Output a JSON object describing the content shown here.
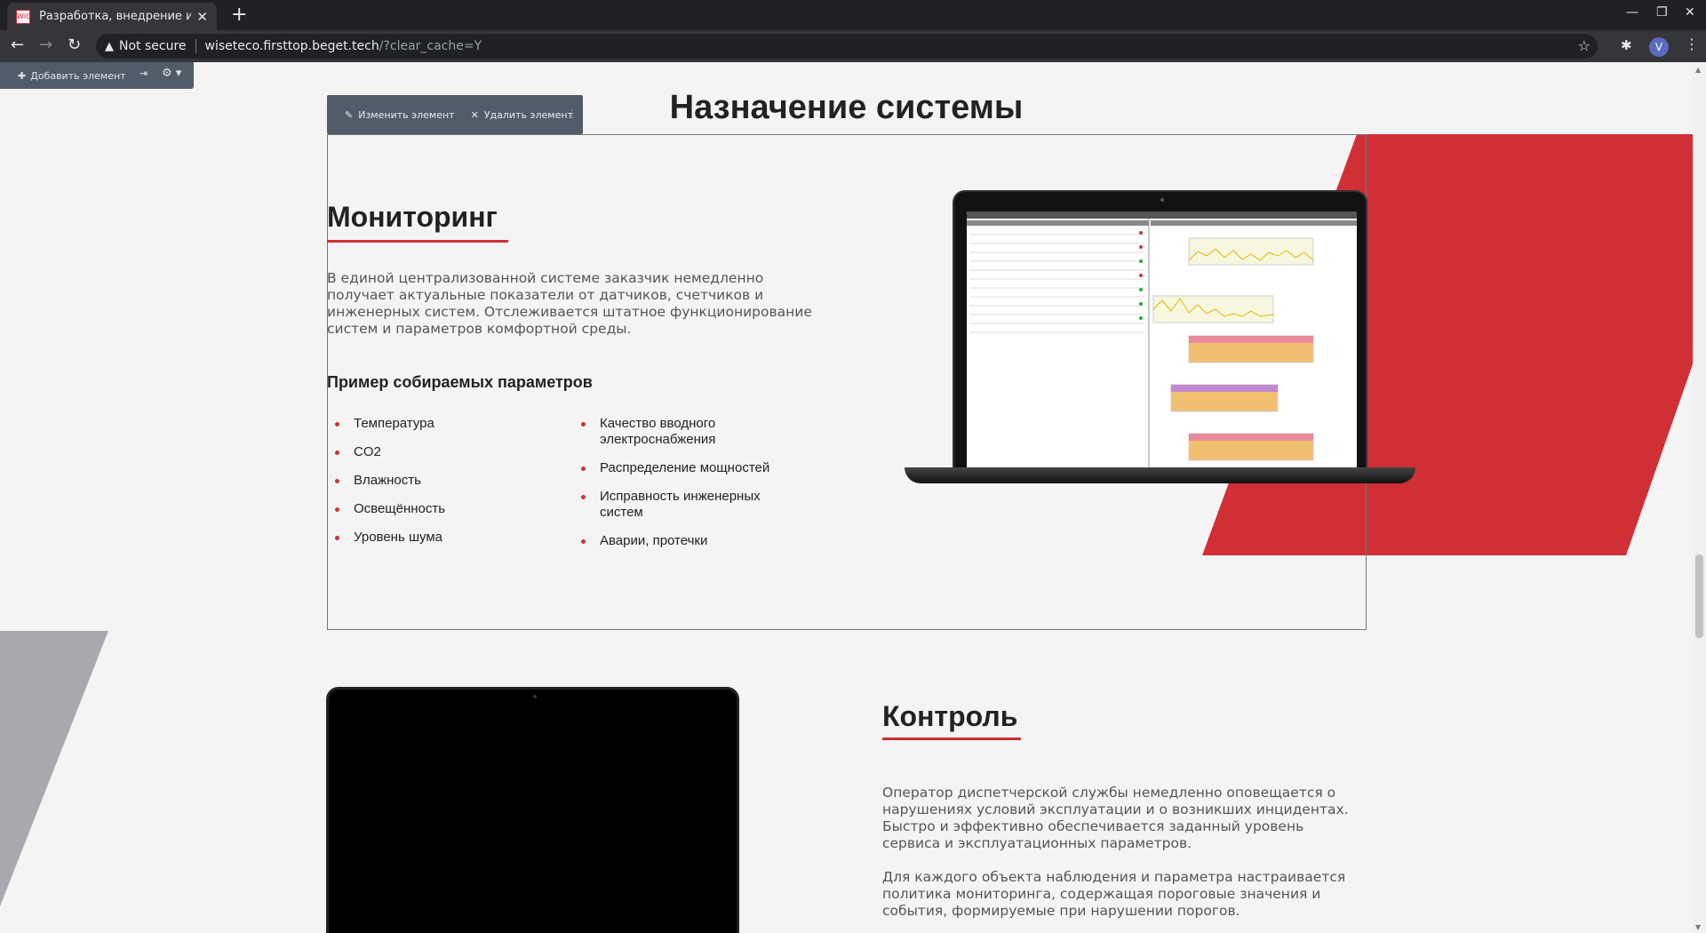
{
  "browser": {
    "tab_title": "Разработка, внедрение и пос",
    "tab_favicon_text": "WIC",
    "security_label": "Not secure",
    "url_host": "wiseteco.firsttop.beget.tech",
    "url_path": "/?clear_cache=Y",
    "profile_initial": "V"
  },
  "admin": {
    "add_element": "Добавить элемент",
    "edit_element": "Изменить элемент",
    "delete_element": "Удалить элемент"
  },
  "page": {
    "section_title": "Назначение системы",
    "monitoring": {
      "heading": "Мониторинг",
      "text": "В единой централизованной системе заказчик немедленно получает актуальные показатели от датчиков, счетчиков и инженерных систем. Отслеживается штатное функционирование систем и параметров комфортной среды.",
      "params_heading": "Пример собираемых параметров",
      "params_left": [
        "Температура",
        "CO2",
        "Влажность",
        "Освещённость",
        "Уровень шума"
      ],
      "params_right": [
        "Качество вводного электроснабжения",
        "Распределение мощностей",
        "Исправность инженерных систем",
        "Аварии, протечки"
      ]
    },
    "control": {
      "heading": "Контроль",
      "text1": "Оператор диспетчерской службы немедленно оповещается о нарушениях условий эксплуатации и о возникших инцидентах. Быстро и эффективно обеспечивается заданный уровень сервиса и эксплуатационных параметров.",
      "text2": "Для каждого объекта наблюдения и параметра настраивается политика мониторинга, содержащая пороговые значения и события, формируемые при нарушении порогов."
    }
  },
  "colors": {
    "accent_red": "#d12f36",
    "admin_panel": "#525c69",
    "decor_grey": "#a7a9ae"
  }
}
